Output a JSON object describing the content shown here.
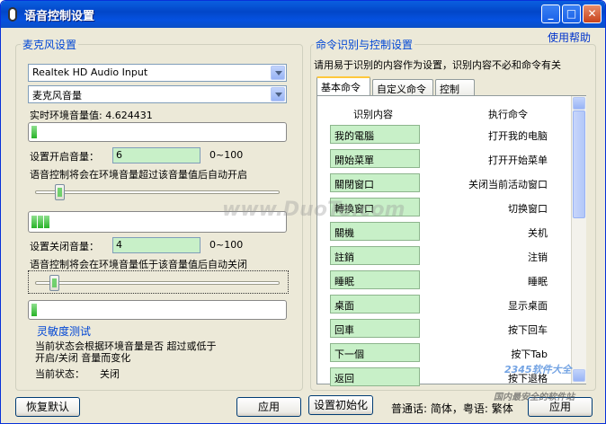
{
  "window": {
    "title": "语音控制设置",
    "buttons": {
      "minimize": "_",
      "maximize": "□",
      "close": "✕"
    }
  },
  "help_link": "使用帮助",
  "mic_group": {
    "title": "麦克风设置",
    "device": "Realtek HD Audio Input",
    "source": "麦克风音量",
    "ambient_label": "实时环境音量值: 4.624431",
    "ambient_level": 0.02,
    "start_label": "设置开启音量：",
    "start_value": "6",
    "start_range": "0~100",
    "start_desc": "语音控制将会在环境音量超过该音量值后自动开启",
    "start_slider": 0.06,
    "start_meter": 0.08,
    "stop_label": "设置关闭音量：",
    "stop_value": "4",
    "stop_range": "0~100",
    "stop_desc": "语音控制将会在环境音量低于该音量值后自动关闭",
    "stop_slider": 0.04,
    "stop_meter": 0.03
  },
  "sensitivity": {
    "title": "灵敏度测试",
    "line1": "当前状态会根据环境音量是否 超过或低于",
    "line2": "开启/关闭 音量而变化",
    "status_label": "当前状态：",
    "status_value": "关闭"
  },
  "cmd_group": {
    "title": "命令识别与控制设置",
    "hint": "请用易于识别的内容作为设置，识别内容不必和命令有关",
    "tabs": [
      "基本命令",
      "自定义命令",
      "控制"
    ],
    "col_recognize": "识别内容",
    "col_execute": "执行命令",
    "rows": [
      {
        "recognize": "我的電腦",
        "execute": "打开我的电脑"
      },
      {
        "recognize": "開始菜單",
        "execute": "打开开始菜单"
      },
      {
        "recognize": "關閉窗口",
        "execute": "关闭当前活动窗口"
      },
      {
        "recognize": "轉換窗口",
        "execute": "切换窗口"
      },
      {
        "recognize": "關機",
        "execute": "关机"
      },
      {
        "recognize": "註銷",
        "execute": "注销"
      },
      {
        "recognize": "睡眠",
        "execute": "睡眠"
      },
      {
        "recognize": "桌面",
        "execute": "显示桌面"
      },
      {
        "recognize": "回車",
        "execute": "按下回车"
      },
      {
        "recognize": "下一個",
        "execute": "按下Tab"
      },
      {
        "recognize": "返回",
        "execute": "按下退格"
      }
    ]
  },
  "footer": {
    "restore_default": "恢复默认",
    "apply_left": "应用",
    "init_settings": "设置初始化",
    "language": "普通话: 简体，粤语: 繁体",
    "apply_right": "应用"
  },
  "watermarks": {
    "center": "www.DuoTe.com",
    "brand": "2345软件大全",
    "brand_sub": "国内最安全的软件站"
  }
}
